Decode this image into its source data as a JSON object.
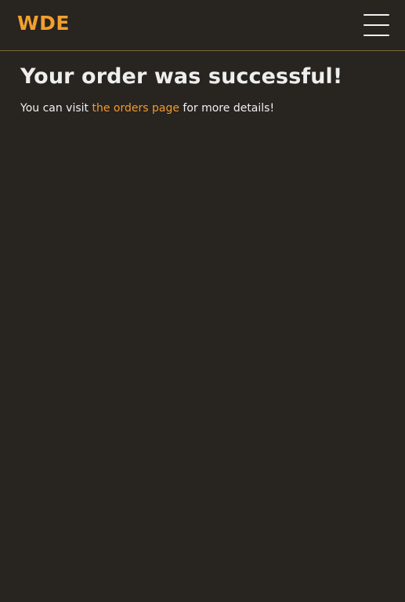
{
  "header": {
    "brand": "WDE",
    "menu_icon": "menu-icon"
  },
  "main": {
    "title": "Your order was successful!",
    "message_prefix": "You can visit ",
    "orders_link_label": "the orders page",
    "message_suffix": " for more details!"
  },
  "colors": {
    "background": "#282420",
    "accent": "#f0a02e",
    "text": "#f2f2f2"
  }
}
